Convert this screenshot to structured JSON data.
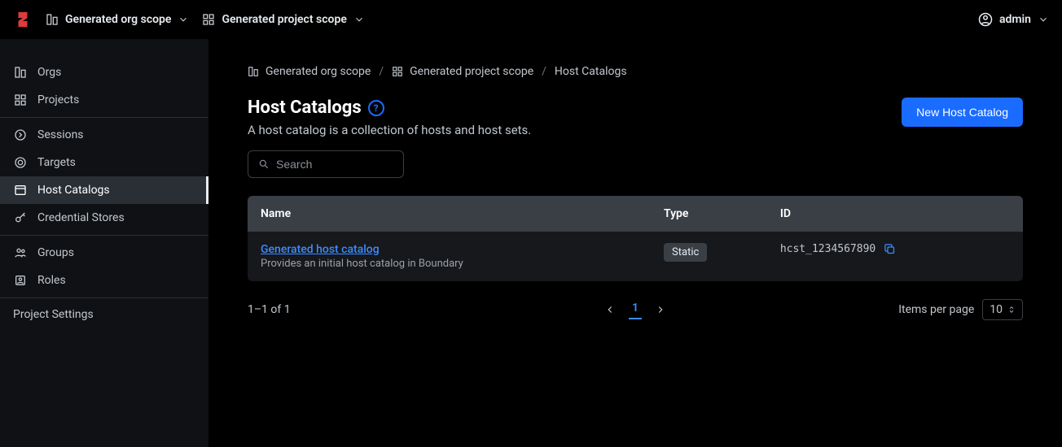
{
  "topbar": {
    "org_scope": "Generated org scope",
    "project_scope": "Generated project scope",
    "user": "admin"
  },
  "sidebar": {
    "orgs": "Orgs",
    "projects": "Projects",
    "sessions": "Sessions",
    "targets": "Targets",
    "host_catalogs": "Host Catalogs",
    "credential_stores": "Credential Stores",
    "groups": "Groups",
    "roles": "Roles",
    "project_settings": "Project Settings"
  },
  "breadcrumb": {
    "org": "Generated org scope",
    "project": "Generated project scope",
    "current": "Host Catalogs"
  },
  "page": {
    "title": "Host Catalogs",
    "subtitle": "A host catalog is a collection of hosts and host sets.",
    "new_button": "New Host Catalog"
  },
  "search": {
    "placeholder": "Search"
  },
  "table": {
    "headers": {
      "name": "Name",
      "type": "Type",
      "id": "ID"
    },
    "rows": [
      {
        "name": "Generated host catalog",
        "desc": "Provides an initial host catalog in Boundary",
        "type": "Static",
        "id": "hcst_1234567890"
      }
    ]
  },
  "pagination": {
    "summary": "1–1 of 1",
    "page": "1",
    "items_per_page_label": "Items per page",
    "items_per_page_value": "10"
  },
  "colors": {
    "accent": "#1a6bff",
    "link": "#3d8bff"
  }
}
